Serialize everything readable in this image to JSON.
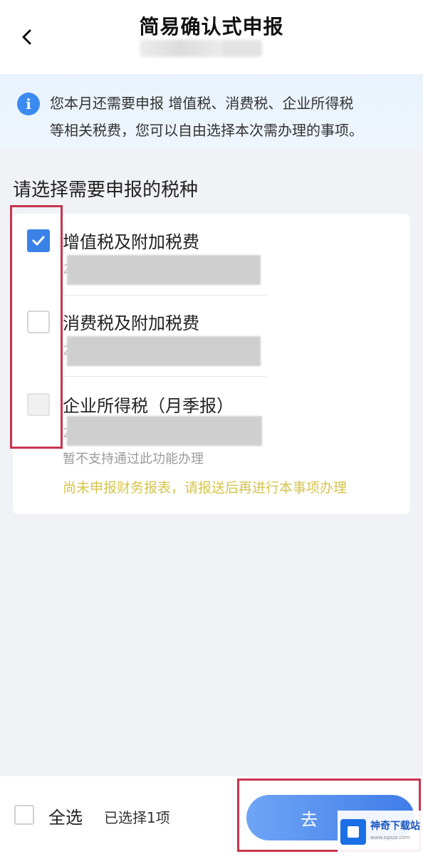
{
  "header": {
    "title": "简易确认式申报",
    "back_icon": "chevron-left-icon"
  },
  "notice": {
    "icon": "info-icon",
    "icon_glyph": "i",
    "line1": "您本月还需要申报 增值税、消费税、企业所得税",
    "line2": "等相关税费，您可以自由选择本次需办理的事项。"
  },
  "section": {
    "title": "请选择需要申报的税种"
  },
  "tax_items": [
    {
      "name": "增值税及附加税费",
      "sub_prefix": "2",
      "checked": true,
      "disabled": false
    },
    {
      "name": "消费税及附加税费",
      "sub_prefix": "2",
      "checked": false,
      "disabled": false
    },
    {
      "name": "企业所得税（月季报）",
      "sub_prefix": "2",
      "checked": false,
      "disabled": true,
      "not_supported": "暂不支持通过此功能办理",
      "warning": "尚未申报财务报表，请报送后再进行本事项办理"
    }
  ],
  "bottom": {
    "select_all": "全选",
    "selected_count": "已选择1项",
    "submit_label": "去"
  },
  "watermark": {
    "name": "神奇下载站",
    "url": "www.sqxzz.com"
  },
  "colors": {
    "accent": "#3b82e8",
    "highlight": "#c8344e",
    "warning": "#d6c44a"
  }
}
